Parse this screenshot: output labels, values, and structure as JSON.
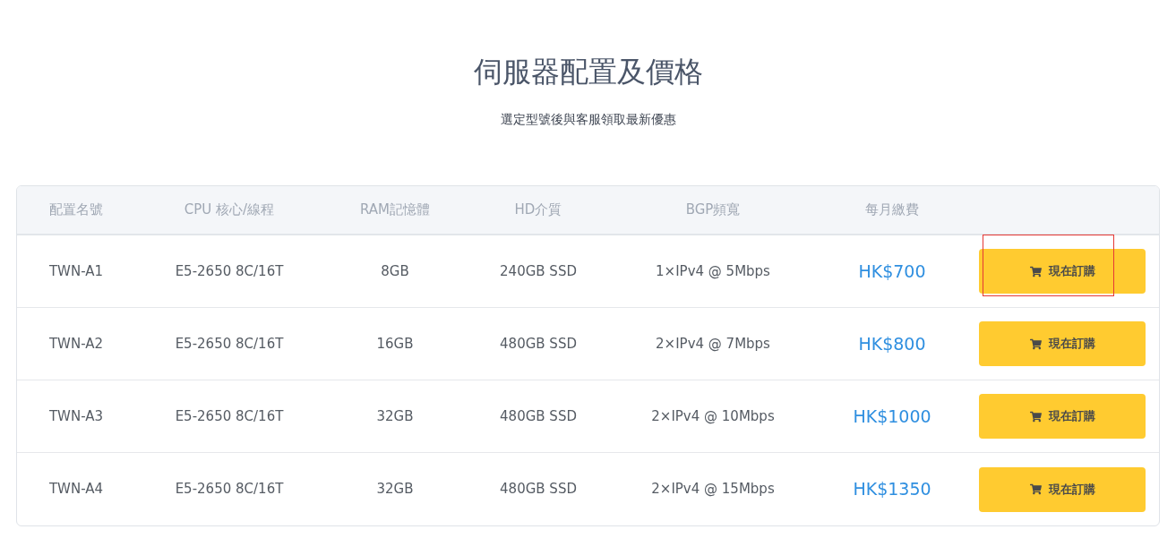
{
  "title": "伺服器配置及價格",
  "subtitle": "選定型號後與客服領取最新優惠",
  "table": {
    "columns": [
      "配置名號",
      "CPU 核心/線程",
      "RAM記憶體",
      "HD介質",
      "BGP頻寬",
      "每月繳費"
    ],
    "rows": [
      {
        "cells": [
          "TWN-A1",
          "E5-2650 8C/16T",
          "8GB",
          "240GB SSD",
          "1×IPv4 @ 5Mbps"
        ],
        "price": "HK$700",
        "button": "現在訂購",
        "highlighted": true
      },
      {
        "cells": [
          "TWN-A2",
          "E5-2650 8C/16T",
          "16GB",
          "480GB SSD",
          "2×IPv4 @ 7Mbps"
        ],
        "price": "HK$800",
        "button": "現在訂購",
        "highlighted": false
      },
      {
        "cells": [
          "TWN-A3",
          "E5-2650 8C/16T",
          "32GB",
          "480GB SSD",
          "2×IPv4 @ 10Mbps"
        ],
        "price": "HK$1000",
        "button": "現在訂購",
        "highlighted": false
      },
      {
        "cells": [
          "TWN-A4",
          "E5-2650 8C/16T",
          "32GB",
          "480GB SSD",
          "2×IPv4 @ 15Mbps"
        ],
        "price": "HK$1350",
        "button": "現在訂購",
        "highlighted": false
      }
    ]
  }
}
